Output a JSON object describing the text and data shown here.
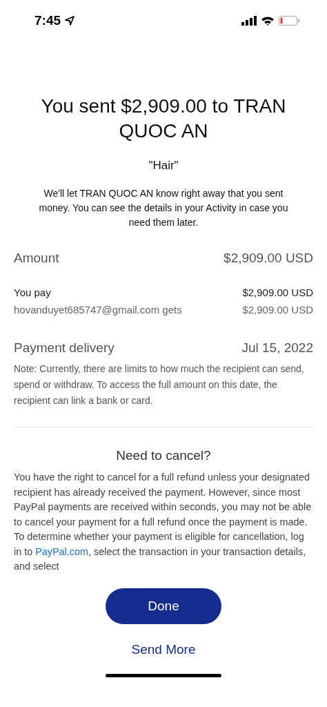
{
  "status_bar": {
    "time": "7:45"
  },
  "title": "You sent $2,909.00 to TRAN QUOC AN",
  "note": "\"Hair\"",
  "message": "We'll let TRAN QUOC AN know right away that you sent money. You can see the details in your Activity in case you need them later.",
  "amount": {
    "label": "Amount",
    "value": "$2,909.00 USD"
  },
  "breakdown": [
    {
      "label": "You pay",
      "value": "$2,909.00 USD",
      "kind": "strong"
    },
    {
      "label": "hovanduyet685747@gmail.com gets",
      "value": "$2,909.00 USD",
      "kind": "muted"
    }
  ],
  "delivery": {
    "label": "Payment delivery",
    "value": "Jul 15, 2022",
    "note": "Note: Currently, there are limits to how much the recipient can send, spend or withdraw. To access the full amount on this date, the recipient can link a bank or card."
  },
  "cancel": {
    "heading": "Need to cancel?",
    "before": "You have the right to cancel for a full refund unless your designated recipient has already received the payment. However, since most PayPal payments are received within seconds, you may not be able to cancel your payment for a full refund once the payment is made. To determine whether your payment is eligible for cancellation, log in to ",
    "link": "PayPal.com",
    "after": ", select the transaction in your transaction details, and select"
  },
  "buttons": {
    "primary": "Done",
    "secondary": "Send More"
  }
}
